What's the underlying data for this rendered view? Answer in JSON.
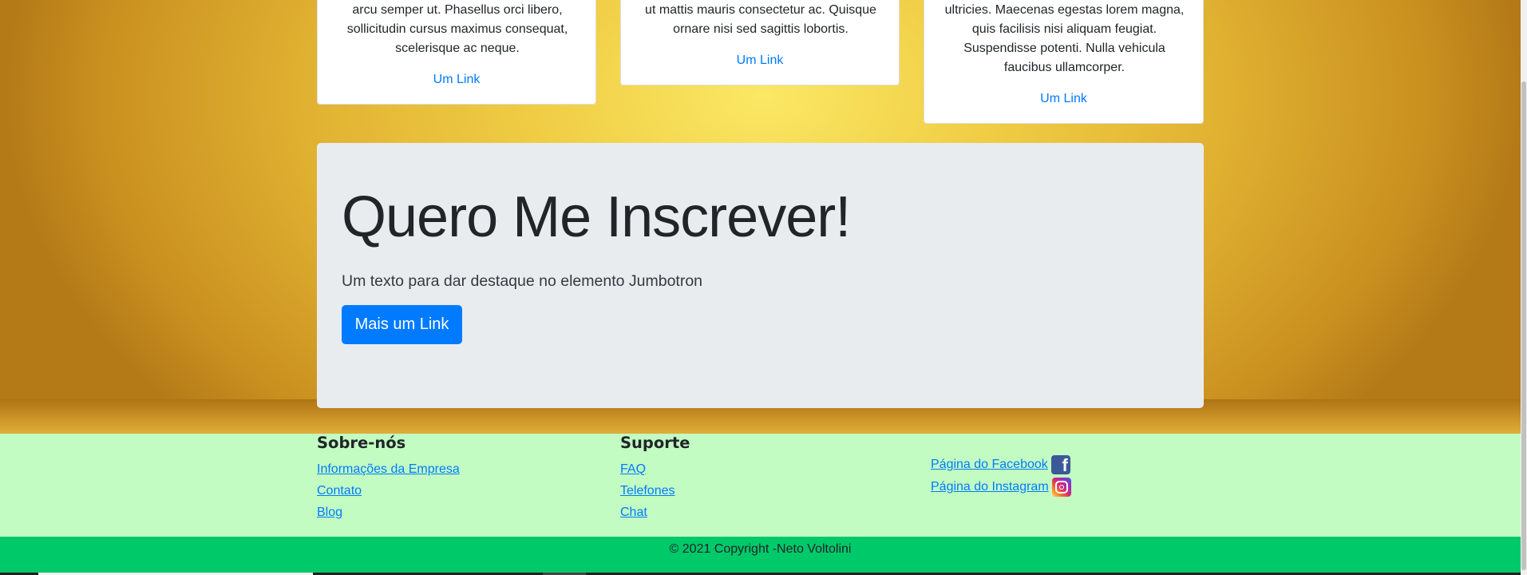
{
  "cards": [
    {
      "text": "arcu semper ut. Phasellus orci libero, sollicitudin cursus maximus consequat, scelerisque ac neque.",
      "link": "Um Link"
    },
    {
      "text": "ut mattis mauris consectetur ac. Quisque ornare nisi sed sagittis lobortis.",
      "link": "Um Link"
    },
    {
      "text": "ultricies. Maecenas egestas lorem magna, quis facilisis nisi aliquam feugiat. Suspendisse potenti. Nulla vehicula faucibus ullamcorper.",
      "link": "Um Link"
    }
  ],
  "jumbotron": {
    "title": "Quero Me Inscrever!",
    "lead": "Um texto para dar destaque no elemento Jumbotron",
    "button": "Mais um Link"
  },
  "footer": {
    "about": {
      "heading": "Sobre-nós",
      "links": [
        "Informações da Empresa",
        "Contato",
        "Blog"
      ]
    },
    "support": {
      "heading": "Suporte",
      "links": [
        "FAQ",
        "Telefones",
        "Chat"
      ]
    },
    "social": {
      "facebook": "Página do Facebook",
      "instagram": "Página do Instagram",
      "facebook_icon": "facebook-icon",
      "instagram_icon": "instagram-icon"
    },
    "copyright": "© 2021 Copyright -Neto Voltolini"
  },
  "colors": {
    "primary": "#007bff",
    "jumbotron_bg": "#e9ecef",
    "footer_bg": "#c2fcc2",
    "copyright_bg": "#00c96a"
  }
}
